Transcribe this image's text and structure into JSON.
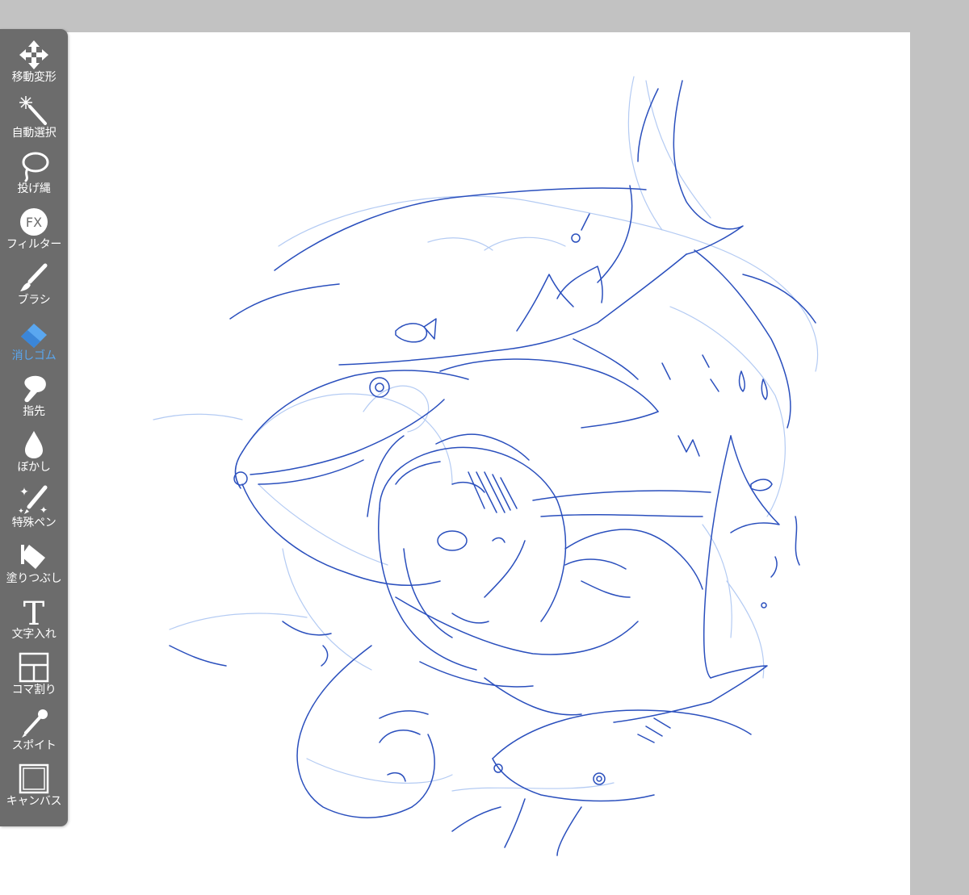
{
  "toolbar": {
    "tools": [
      {
        "label": "移動変形",
        "icon": "move-transform-icon",
        "active": false
      },
      {
        "label": "自動選択",
        "icon": "magic-wand-icon",
        "active": false
      },
      {
        "label": "投げ縄",
        "icon": "lasso-icon",
        "active": false
      },
      {
        "label": "フィルター",
        "icon": "fx-filter-icon",
        "active": false
      },
      {
        "label": "ブラシ",
        "icon": "brush-icon",
        "active": false
      },
      {
        "label": "消しゴム",
        "icon": "eraser-icon",
        "active": true
      },
      {
        "label": "指先",
        "icon": "finger-smudge-icon",
        "active": false
      },
      {
        "label": "ぼかし",
        "icon": "blur-drop-icon",
        "active": false
      },
      {
        "label": "特殊ペン",
        "icon": "special-pen-icon",
        "active": false
      },
      {
        "label": "塗りつぶし",
        "icon": "fill-bucket-icon",
        "active": false
      },
      {
        "label": "文字入れ",
        "icon": "text-tool-icon",
        "active": false
      },
      {
        "label": "コマ割り",
        "icon": "panel-split-icon",
        "active": false
      },
      {
        "label": "スポイト",
        "icon": "eyedropper-icon",
        "active": false
      },
      {
        "label": "キャンバス",
        "icon": "canvas-icon",
        "active": false
      }
    ]
  },
  "colors": {
    "toolbar_bg": "#6c6c6c",
    "active_tool": "#5aa7f0",
    "sketch_dark": "#2448b8",
    "sketch_light": "#aec6f2",
    "background": "#c2c2c2",
    "canvas": "#ffffff"
  }
}
